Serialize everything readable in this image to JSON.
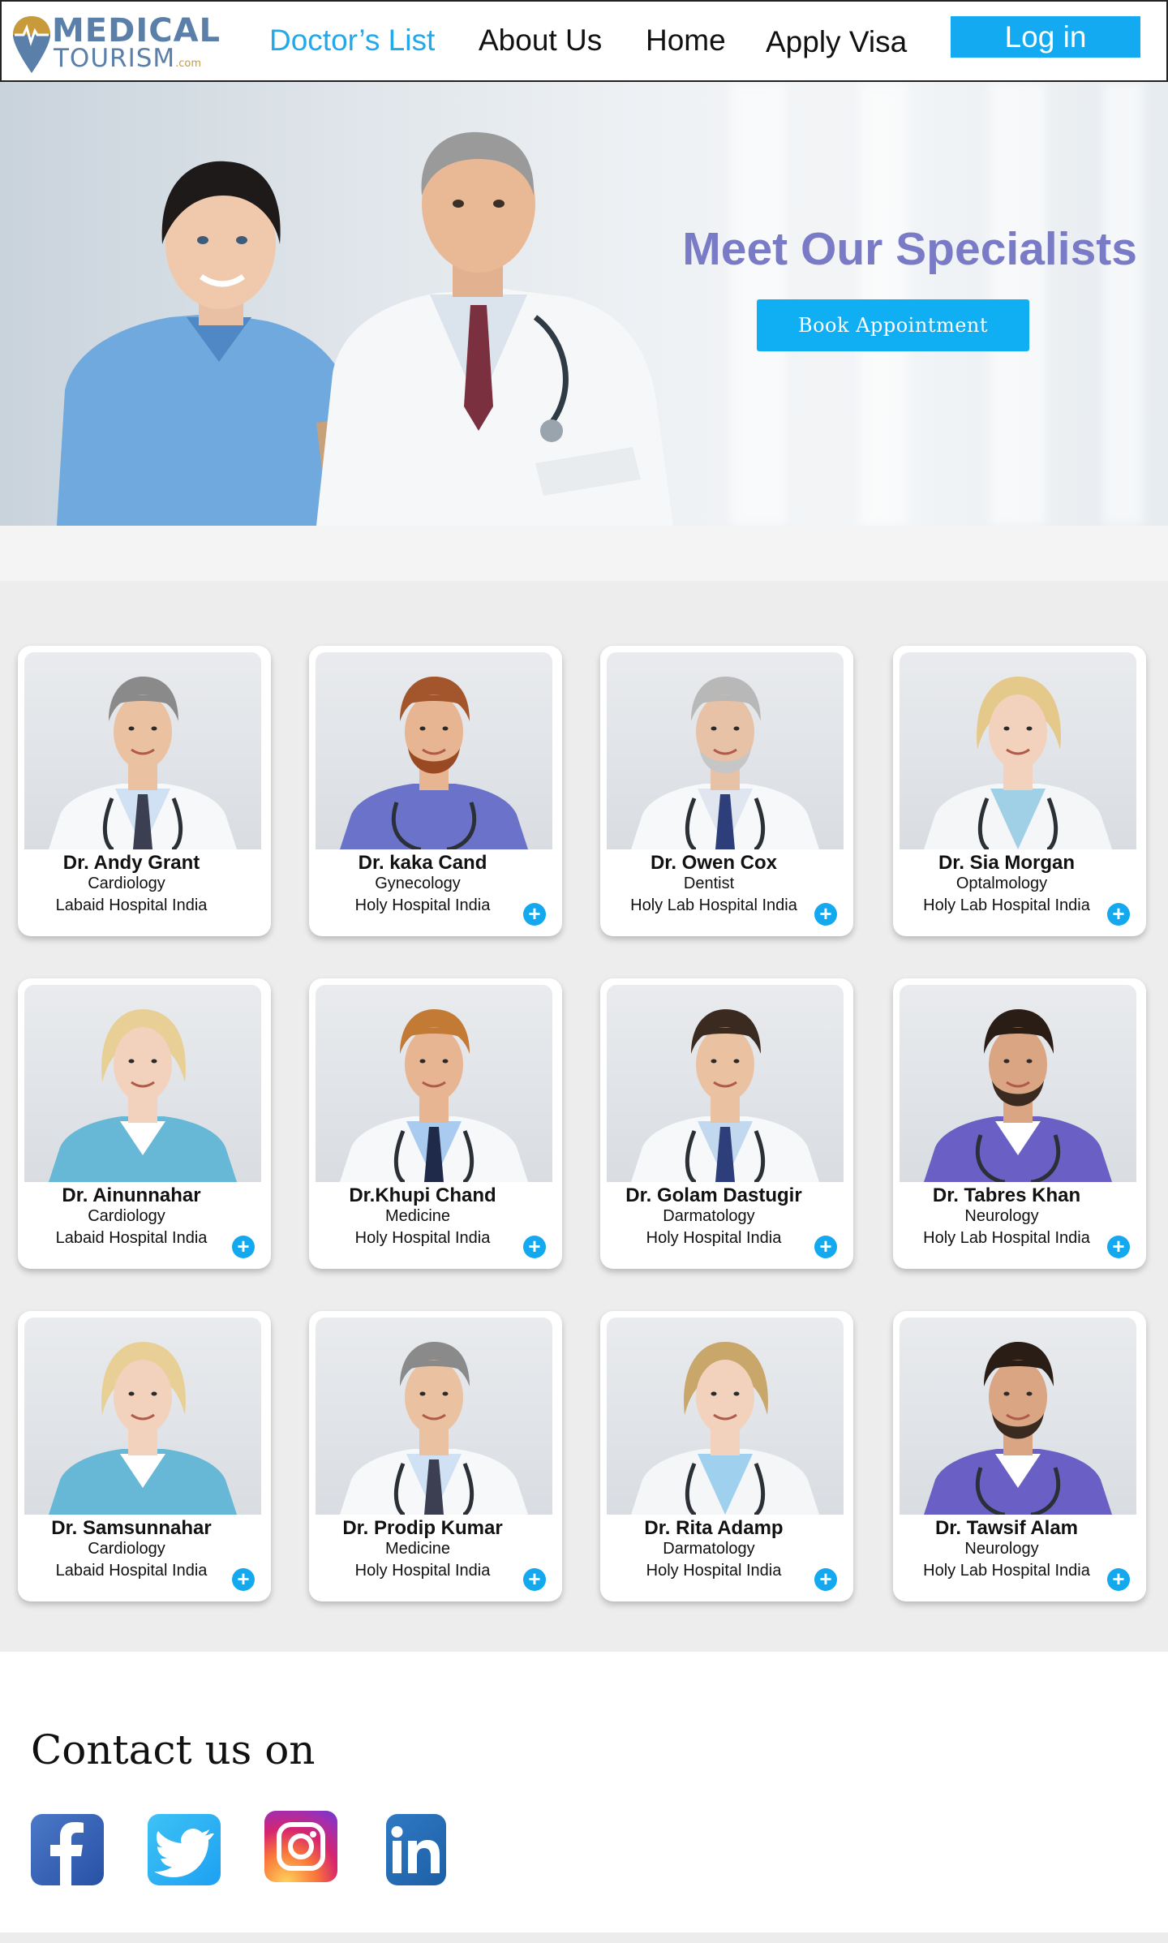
{
  "brand": {
    "line1": "MEDICAL",
    "line2": "TOURISM",
    "suffix": ".com"
  },
  "nav": {
    "items": [
      {
        "label": "Doctor’s List",
        "active": true
      },
      {
        "label": "About Us"
      },
      {
        "label": "Home"
      },
      {
        "label": "Apply Visa"
      }
    ],
    "login_label": "Log in"
  },
  "hero": {
    "title": "Meet Our Specialists",
    "button_label": "Book Appointment"
  },
  "doctors": [
    {
      "name": "Dr. Andy Grant",
      "specialty": "Cardiology",
      "hospital": "Labaid Hospital India",
      "add": ""
    },
    {
      "name": "Dr. kaka Cand",
      "specialty": "Gynecology",
      "hospital": "Holy Hospital India",
      "add": "+"
    },
    {
      "name": "Dr. Owen Cox",
      "specialty": "Dentist",
      "hospital": "Holy Lab Hospital India",
      "add": "+"
    },
    {
      "name": "Dr. Sia Morgan",
      "specialty": "Optalmology",
      "hospital": "Holy Lab Hospital India",
      "add": "+"
    },
    {
      "name": "Dr. Ainunnahar",
      "specialty": "Cardiology",
      "hospital": "Labaid Hospital India",
      "add": "+"
    },
    {
      "name": "Dr.Khupi Chand",
      "specialty": "Medicine",
      "hospital": "Holy Hospital India",
      "add": "+"
    },
    {
      "name": "Dr. Golam Dastugir",
      "specialty": "Darmatology",
      "hospital": "Holy Hospital India",
      "add": "+"
    },
    {
      "name": "Dr. Tabres Khan",
      "specialty": "Neurology",
      "hospital": "Holy Lab Hospital India",
      "add": "+"
    },
    {
      "name": "Dr. Samsunnahar",
      "specialty": "Cardiology",
      "hospital": "Labaid Hospital India",
      "add": "+"
    },
    {
      "name": "Dr. Prodip Kumar",
      "specialty": "Medicine",
      "hospital": "Holy Hospital India",
      "add": "+"
    },
    {
      "name": "Dr. Rita Adamp",
      "specialty": "Darmatology",
      "hospital": "Holy Hospital India",
      "add": "+"
    },
    {
      "name": "Dr. Tawsif Alam",
      "specialty": "Neurology",
      "hospital": "Holy Lab Hospital India",
      "add": "+"
    }
  ],
  "contact": {
    "title": "Contact us on",
    "socials": [
      "facebook-icon",
      "twitter-icon",
      "instagram-icon",
      "linkedin-icon"
    ]
  },
  "colors": {
    "accent": "#14aaf2",
    "hero_title": "#7a7bc6",
    "logo": "#5a7fa8"
  }
}
